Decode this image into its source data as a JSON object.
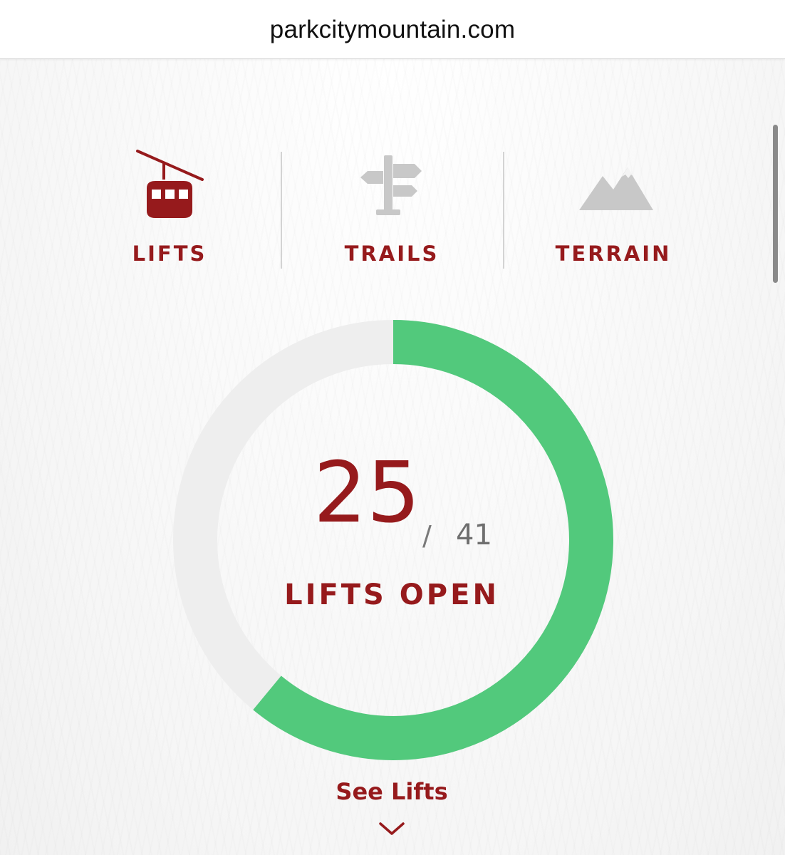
{
  "browser": {
    "url": "parkcitymountain.com"
  },
  "tabs": [
    {
      "label": "LIFTS",
      "icon": "gondola-icon",
      "active": true
    },
    {
      "label": "TRAILS",
      "icon": "signpost-icon",
      "active": false
    },
    {
      "label": "TERRAIN",
      "icon": "mountain-icon",
      "active": false
    }
  ],
  "status": {
    "open": "25",
    "separator": "/",
    "total": "41",
    "label": "LIFTS OPEN",
    "open_fraction": 0.6098
  },
  "see_link": {
    "label": "See Lifts",
    "icon": "chevron-down-icon"
  },
  "colors": {
    "brand_red": "#961a1c",
    "progress_green": "#52c97c",
    "track_gray": "#eeeeee",
    "inactive_icon": "#c8c8c8"
  }
}
